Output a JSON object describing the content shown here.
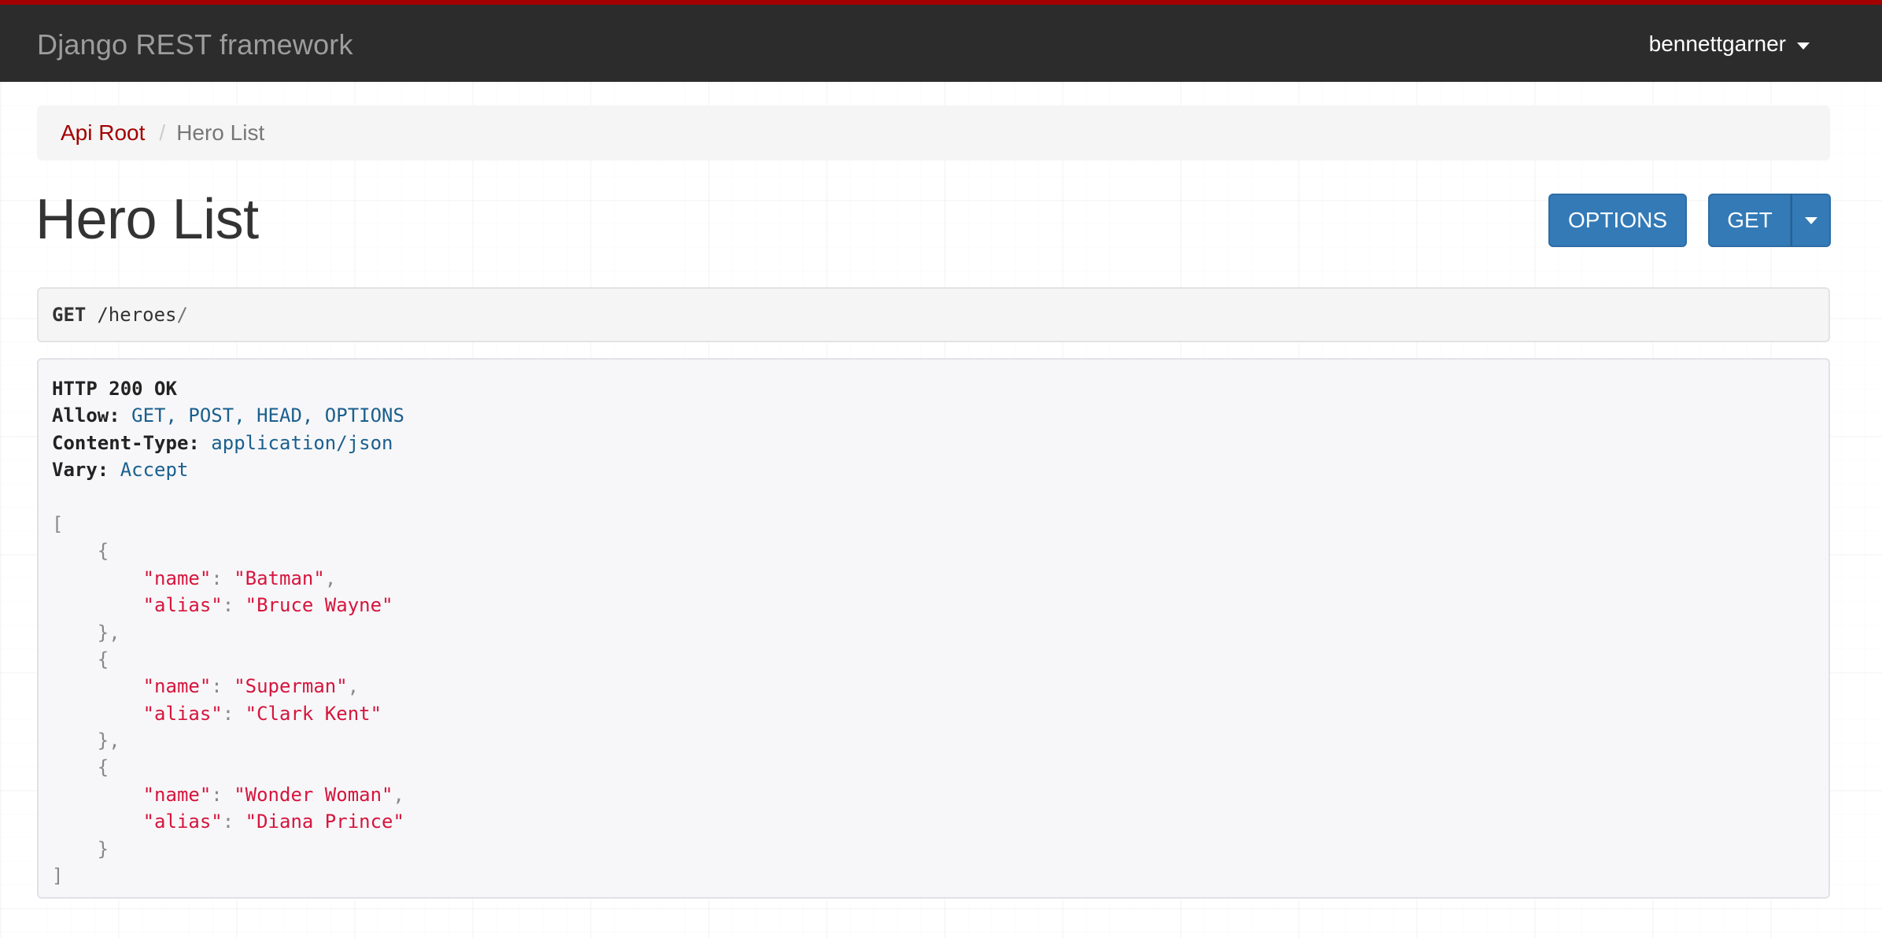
{
  "navbar": {
    "brand": "Django REST framework",
    "user": "bennettgarner",
    "accent_color": "#a30000",
    "background_color": "#2c2c2c"
  },
  "breadcrumb": {
    "items": [
      {
        "label": "Api Root",
        "active": false
      },
      {
        "label": "Hero List",
        "active": true
      }
    ],
    "separator": "/"
  },
  "page": {
    "title": "Hero List"
  },
  "toolbar": {
    "options_label": "OPTIONS",
    "get_label": "GET",
    "button_color": "#337ab7"
  },
  "request": {
    "method": "GET",
    "path": "/heroes",
    "trailing": "/"
  },
  "response": {
    "status": "HTTP 200 OK",
    "headers": [
      {
        "key": "Allow:",
        "value": "GET, POST, HEAD, OPTIONS"
      },
      {
        "key": "Content-Type:",
        "value": "application/json"
      },
      {
        "key": "Vary:",
        "value": "Accept"
      }
    ],
    "body": [
      {
        "name": "Batman",
        "alias": "Bruce Wayne"
      },
      {
        "name": "Superman",
        "alias": "Clark Kent"
      },
      {
        "name": "Wonder Woman",
        "alias": "Diana Prince"
      }
    ],
    "keys": {
      "name": "\"name\"",
      "alias": "\"alias\""
    }
  }
}
